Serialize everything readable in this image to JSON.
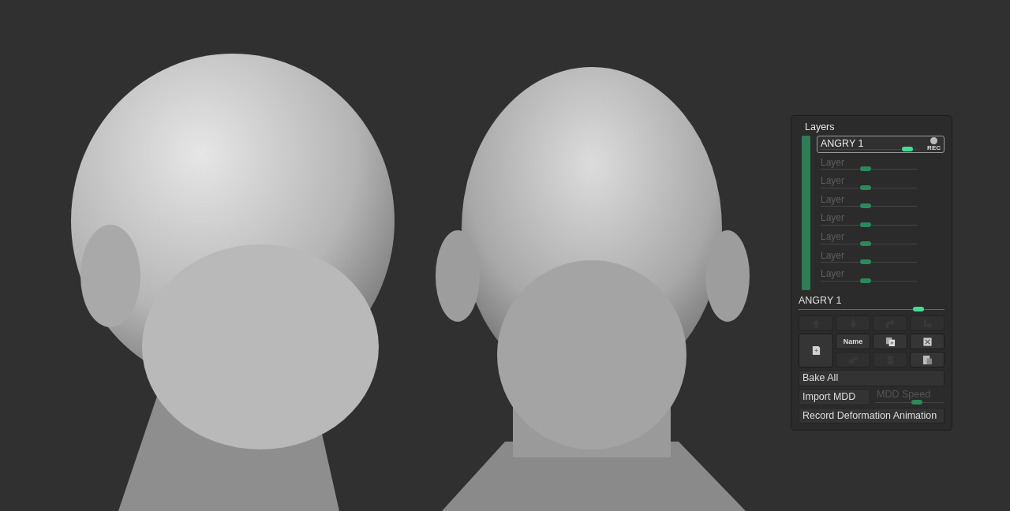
{
  "layers_panel": {
    "title": "Layers",
    "layers": [
      {
        "name": "ANGRY 1",
        "selected": true,
        "level": 0.9,
        "rec_label": "REC"
      },
      {
        "name": "Layer",
        "selected": false,
        "level": 0.47
      },
      {
        "name": "Layer",
        "selected": false,
        "level": 0.47
      },
      {
        "name": "Layer",
        "selected": false,
        "level": 0.47
      },
      {
        "name": "Layer",
        "selected": false,
        "level": 0.47
      },
      {
        "name": "Layer",
        "selected": false,
        "level": 0.47
      },
      {
        "name": "Layer",
        "selected": false,
        "level": 0.47
      },
      {
        "name": "Layer",
        "selected": false,
        "level": 0.47
      }
    ],
    "strength": {
      "label": "ANGRY 1",
      "level": 0.82
    },
    "tool_buttons": [
      {
        "kind": "up",
        "disabled": true
      },
      {
        "kind": "down",
        "disabled": true
      },
      {
        "kind": "redo",
        "disabled": true
      },
      {
        "kind": "bend",
        "disabled": true
      },
      {
        "kind": "new",
        "disabled": false
      },
      {
        "kind": "name",
        "label": "Name",
        "disabled": false
      },
      {
        "kind": "copy",
        "disabled": false
      },
      {
        "kind": "delete",
        "disabled": false
      },
      {
        "kind": "stack",
        "disabled": true
      },
      {
        "kind": "split",
        "disabled": true
      },
      {
        "kind": "corner",
        "disabled": false
      }
    ],
    "bake_button": "Bake All",
    "import_button": "Import MDD",
    "mdd_speed": {
      "label": "MDD Speed",
      "disabled": true,
      "level": 0.6
    },
    "record_button": "Record Deformation Animation"
  }
}
